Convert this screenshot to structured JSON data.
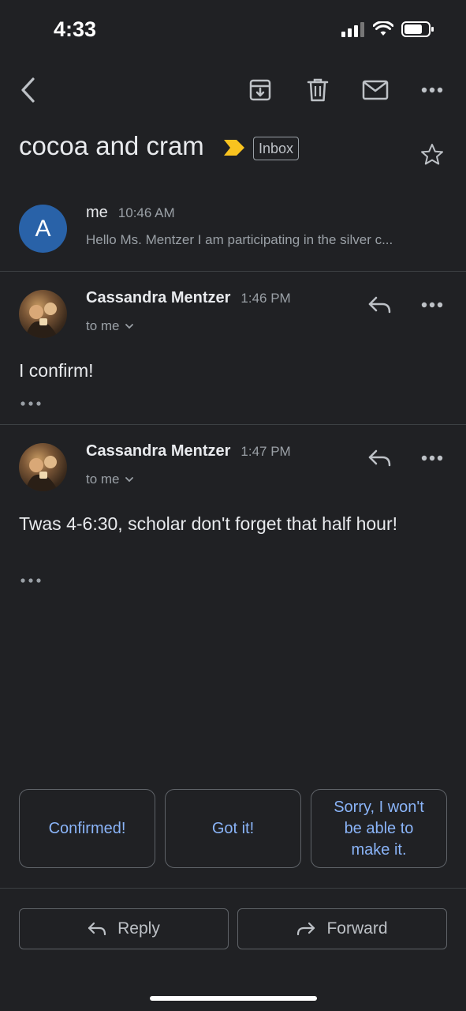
{
  "status_bar": {
    "time": "4:33"
  },
  "toolbar": {
    "back_icon": "chevron-left-icon",
    "archive_icon": "archive-icon",
    "delete_icon": "trash-icon",
    "mark_unread_icon": "mail-icon",
    "more_icon": "more-horizontal-icon"
  },
  "thread": {
    "subject": "cocoa and cram",
    "label": "Inbox",
    "important_color": "#f9c31f"
  },
  "messages": [
    {
      "avatar_letter": "A",
      "sender": "me",
      "time": "10:46 AM",
      "snippet": "Hello Ms. Mentzer I am participating in the silver c..."
    },
    {
      "sender": "Cassandra Mentzer",
      "time": "1:46 PM",
      "recipient": "to me",
      "body": "I confirm!"
    },
    {
      "sender": "Cassandra Mentzer",
      "time": "1:47 PM",
      "recipient": "to me",
      "body": "Twas 4-6:30, scholar don't forget that half hour!"
    }
  ],
  "smart_replies": [
    "Confirmed!",
    "Got it!",
    "Sorry, I won't be able to make it."
  ],
  "actions": {
    "reply": "Reply",
    "forward": "Forward"
  },
  "colors": {
    "background": "#202124",
    "accent": "#8ab4f8",
    "avatar": "#2962a8"
  }
}
